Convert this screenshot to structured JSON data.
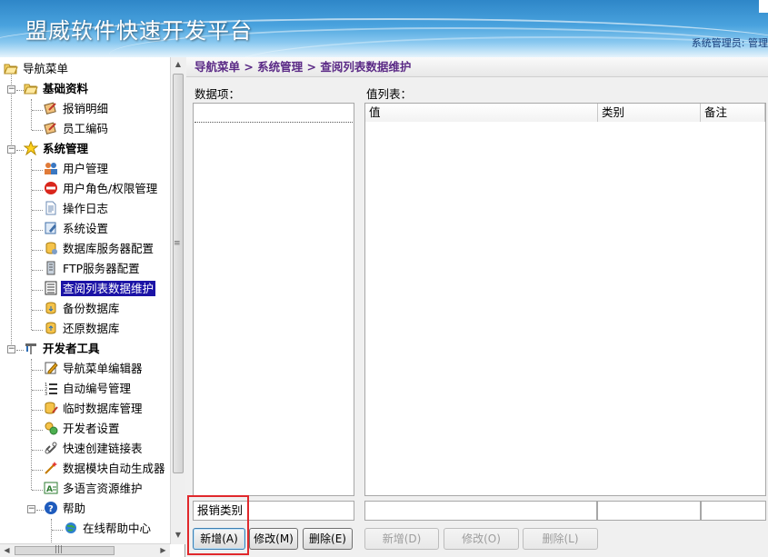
{
  "header": {
    "app_title": "盟威软件快速开发平台",
    "user_info": "系统管理员: 管理"
  },
  "tree": {
    "root": "导航菜单",
    "groups": [
      {
        "label": "基础资料",
        "icon": "folder-open-icon",
        "items": [
          {
            "label": "报销明细",
            "icon": "form-icon"
          },
          {
            "label": "员工编码",
            "icon": "form-icon"
          }
        ]
      },
      {
        "label": "系统管理",
        "icon": "star-icon",
        "items": [
          {
            "label": "用户管理",
            "icon": "users-icon"
          },
          {
            "label": "用户角色/权限管理",
            "icon": "no-entry-icon"
          },
          {
            "label": "操作日志",
            "icon": "document-icon"
          },
          {
            "label": "系统设置",
            "icon": "settings-icon"
          },
          {
            "label": "数据库服务器配置",
            "icon": "database-server-icon"
          },
          {
            "label": "FTP服务器配置",
            "icon": "ftp-icon"
          },
          {
            "label": "查阅列表数据维护",
            "icon": "list-icon",
            "selected": true
          },
          {
            "label": "备份数据库",
            "icon": "backup-icon"
          },
          {
            "label": "还原数据库",
            "icon": "restore-icon"
          }
        ]
      },
      {
        "label": "开发者工具",
        "icon": "tools-icon",
        "items": [
          {
            "label": "导航菜单编辑器",
            "icon": "edit-icon"
          },
          {
            "label": "自动编号管理",
            "icon": "numbered-list-icon"
          },
          {
            "label": "临时数据库管理",
            "icon": "temp-db-icon"
          },
          {
            "label": "开发者设置",
            "icon": "developer-icon"
          },
          {
            "label": "快速创建链接表",
            "icon": "link-icon"
          },
          {
            "label": "数据模块自动生成器",
            "icon": "wand-icon"
          },
          {
            "label": "多语言资源维护",
            "icon": "language-icon"
          }
        ]
      },
      {
        "label": "帮助",
        "icon": "help-icon",
        "items": [
          {
            "label": "在线帮助中心",
            "icon": "globe-icon"
          }
        ]
      }
    ]
  },
  "breadcrumb": "导航菜单 > 系统管理 > 查阅列表数据维护",
  "left_pane": {
    "label": "数据项：",
    "input_value": "报销类别",
    "buttons": {
      "add": "新增(A)",
      "modify": "修改(M)",
      "delete": "删除(E)"
    }
  },
  "right_pane": {
    "label": "值列表：",
    "columns": [
      "值",
      "类别",
      "备注"
    ],
    "buttons": {
      "add": "新增(D)",
      "modify": "修改(O)",
      "delete": "删除(L)"
    }
  }
}
